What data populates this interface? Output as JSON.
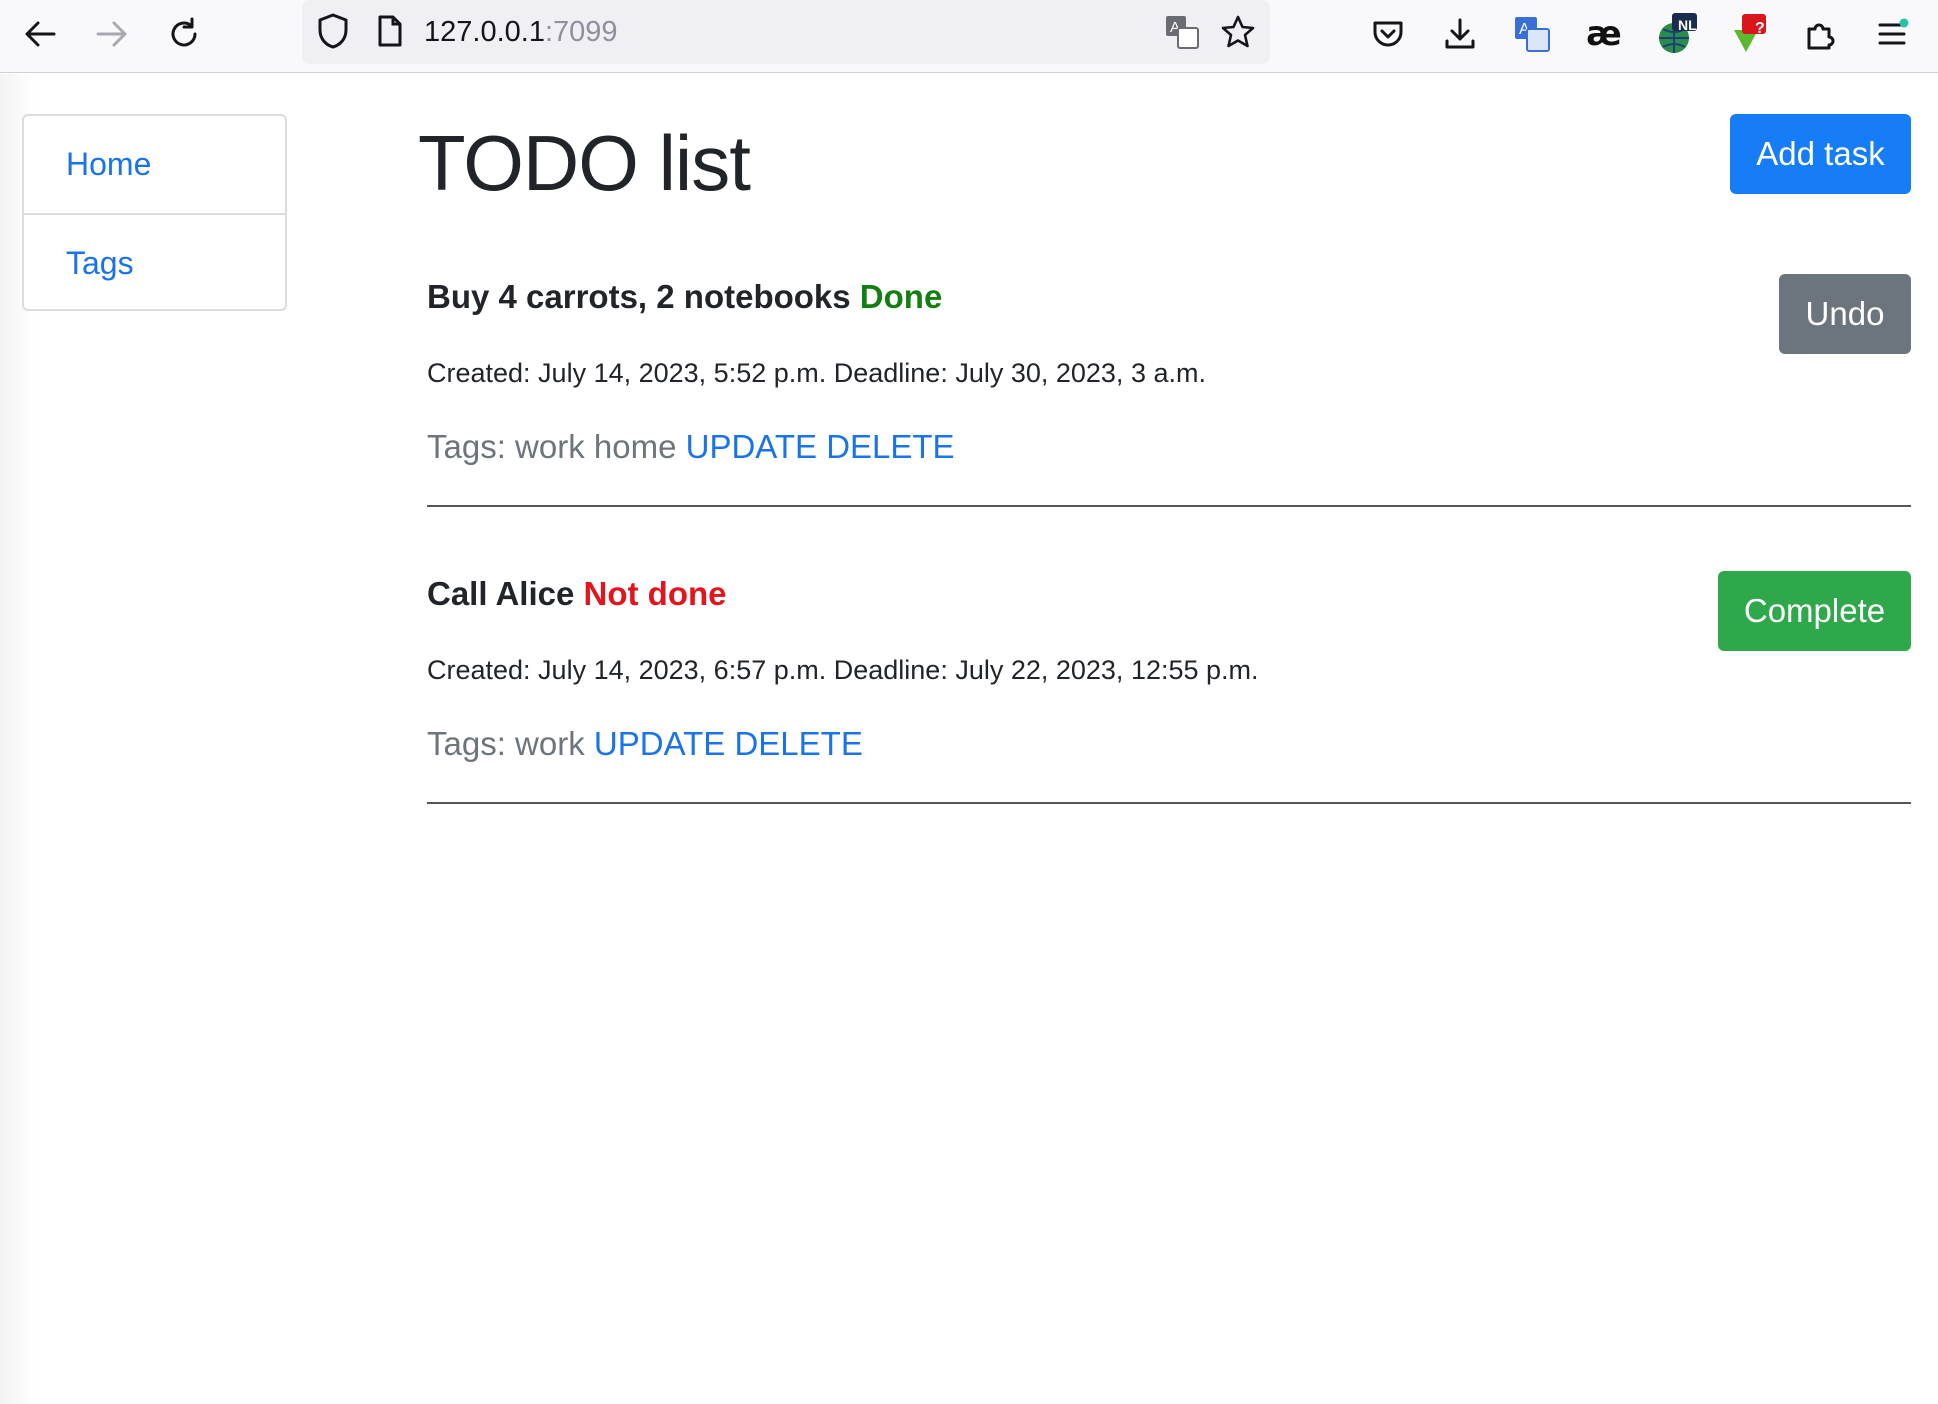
{
  "browser": {
    "url_host": "127.0.0.1",
    "url_port": ":7099",
    "ext_nl_badge": "NL",
    "ext_question_badge": "?",
    "ext_ae_label": "æ",
    "translate_glyph": "A"
  },
  "sidebar": {
    "items": [
      {
        "label": "Home"
      },
      {
        "label": "Tags"
      }
    ]
  },
  "header": {
    "title": "TODO list",
    "add_task_label": "Add task"
  },
  "tasks": [
    {
      "title": "Buy 4 carrots, 2 notebooks",
      "status": "Done",
      "meta": "Created: July 14, 2023, 5:52 p.m. Deadline: July 30, 2023, 3 a.m.",
      "tags_prefix": "Tags: work home",
      "update_label": "UPDATE",
      "delete_label": "DELETE",
      "action_label": "Undo"
    },
    {
      "title": "Call Alice",
      "status": "Not done",
      "meta": "Created: July 14, 2023, 6:57 p.m. Deadline: July 22, 2023, 12:55 p.m.",
      "tags_prefix": "Tags: work",
      "update_label": "UPDATE",
      "delete_label": "DELETE",
      "action_label": "Complete"
    }
  ],
  "colors": {
    "primary": "#167df7",
    "secondary": "#6c757d",
    "success": "#2ea84a",
    "done": "#137f12",
    "not_done": "#e3141b",
    "link": "#1a73e8"
  }
}
